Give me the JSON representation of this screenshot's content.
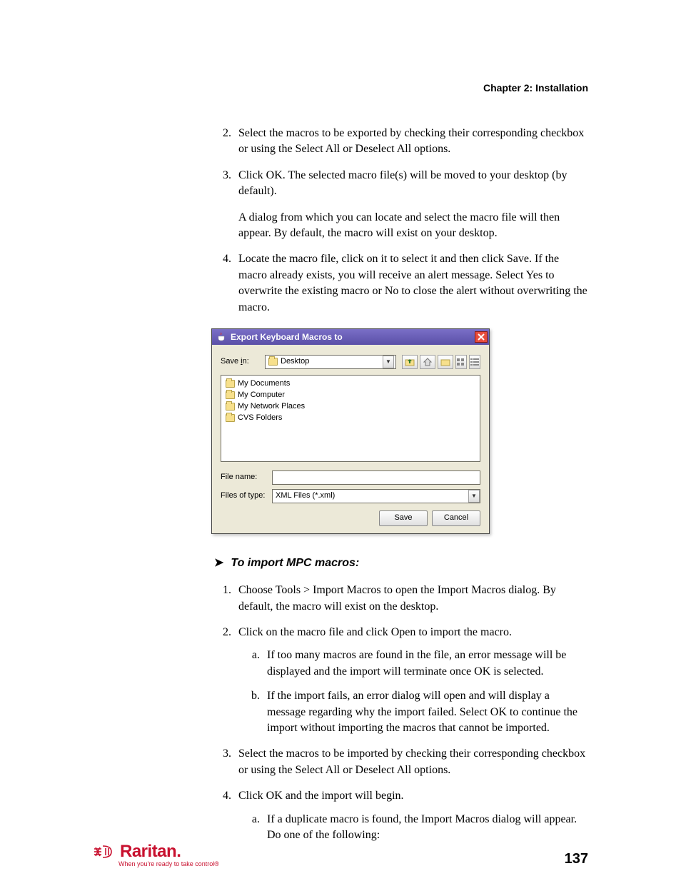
{
  "chapter_heading": "Chapter 2: Installation",
  "steps_a": {
    "s2": "Select the macros to be exported by checking their corresponding checkbox or using the Select All or Deselect All options.",
    "s3": "Click OK. The selected macro file(s) will be moved to your desktop (by default).",
    "s3_para": "A dialog from which you can locate and select the macro file will then appear. By default, the macro will exist on your desktop.",
    "s4": "Locate the macro file, click on it to select it and then click Save. If the macro already exists, you will receive an alert message. Select Yes to overwrite the existing macro or No to close the alert without overwriting the macro."
  },
  "dialog": {
    "title": "Export Keyboard Macros to",
    "save_in_label": "Save in:",
    "save_in_value": "Desktop",
    "files": [
      "My Documents",
      "My Computer",
      "My Network Places",
      "CVS Folders"
    ],
    "file_name_label": "File name:",
    "file_name_value": "",
    "file_type_label": "Files of type:",
    "file_type_value": "XML Files (*.xml)",
    "save_btn": "Save",
    "cancel_btn": "Cancel"
  },
  "subheading": "To import MPC macros:",
  "steps_b": {
    "s1": "Choose Tools > Import Macros to open the Import Macros dialog. By default, the macro will exist on the desktop.",
    "s2": "Click on the macro file and click Open to import the macro.",
    "s2a": "If too many macros are found in the file, an error message will be displayed and the import will terminate once OK is selected.",
    "s2b": "If the import fails, an error dialog will open and will display a message regarding why the import failed. Select OK to continue the import without importing the macros that cannot be imported.",
    "s3": "Select the macros to be imported by checking their corresponding checkbox or using the Select All or Deselect All options.",
    "s4": "Click OK and the import will begin.",
    "s4a": "If a duplicate macro is found, the Import Macros dialog will appear. Do one of the following:"
  },
  "footer": {
    "brand": "Raritan.",
    "tagline": "When you're ready to take control®",
    "page_number": "137"
  }
}
